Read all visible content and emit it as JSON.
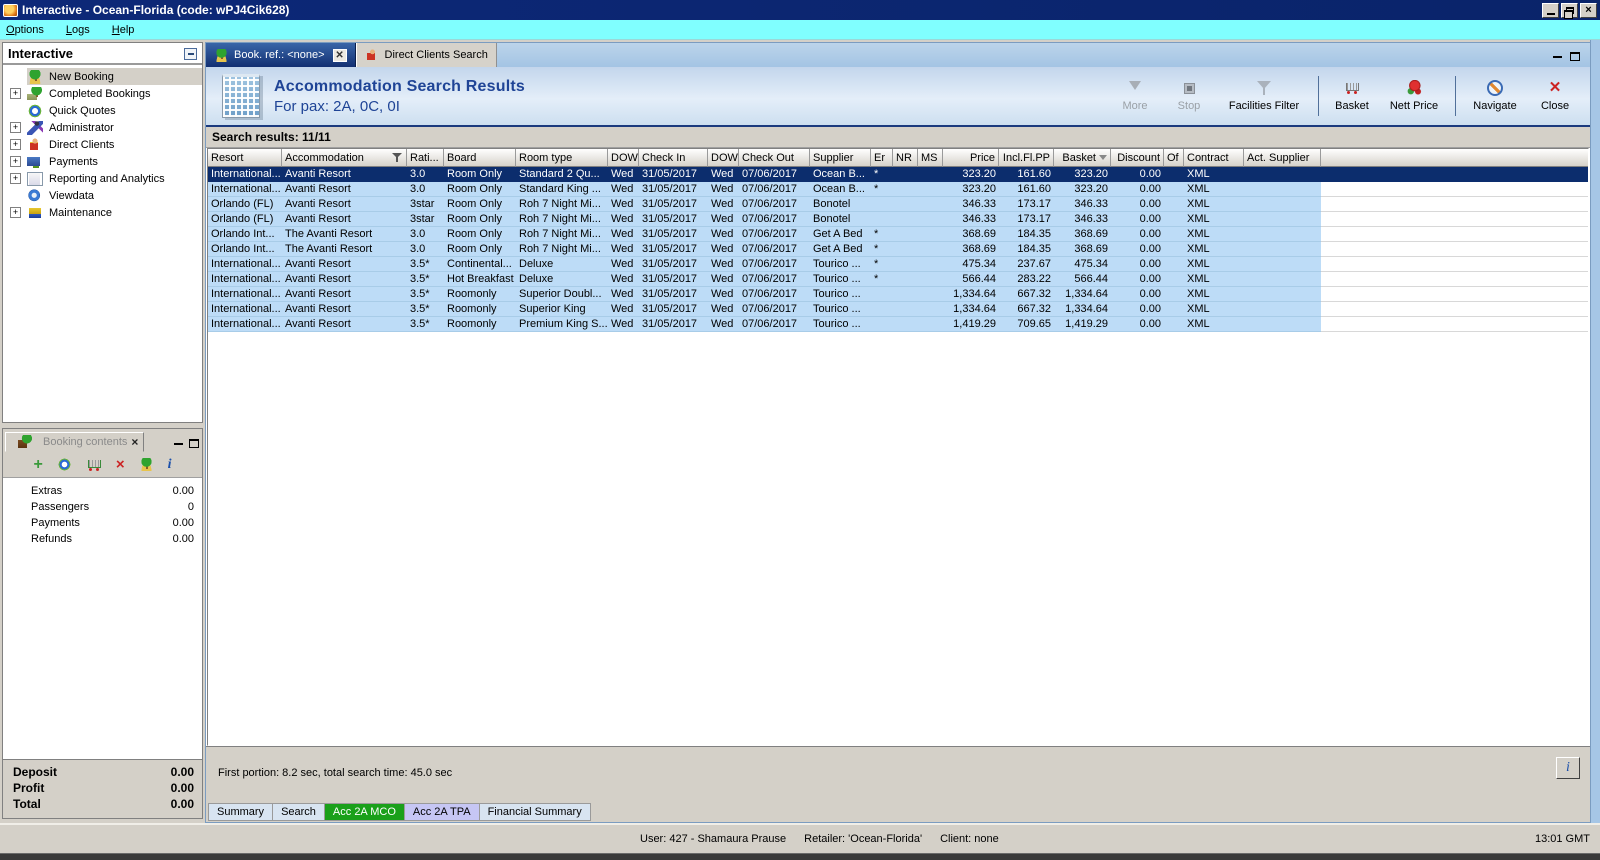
{
  "window": {
    "title": "Interactive - Ocean-Florida (code: wPJ4Cik628)",
    "time": "13:01 GMT",
    "status_user": "User: 427 - Shamaura Prause",
    "status_retailer": "Retailer: 'Ocean-Florida'",
    "status_client": "Client: none"
  },
  "menu": {
    "items": [
      "Options",
      "Logs",
      "Help"
    ]
  },
  "sidebar": {
    "title": "Interactive",
    "items": [
      {
        "label": "New Booking",
        "icon": "palm-tree-icon",
        "expandable": false,
        "selected": true
      },
      {
        "label": "Completed Bookings",
        "icon": "palm-money-icon",
        "expandable": true
      },
      {
        "label": "Quick Quotes",
        "icon": "clock-icon",
        "expandable": false
      },
      {
        "label": "Administrator",
        "icon": "admin-icon",
        "expandable": true
      },
      {
        "label": "Direct Clients",
        "icon": "person-icon",
        "expandable": true
      },
      {
        "label": "Payments",
        "icon": "payments-icon",
        "expandable": true
      },
      {
        "label": "Reporting and Analytics",
        "icon": "report-icon",
        "expandable": true
      },
      {
        "label": "Viewdata",
        "icon": "globe-icon",
        "expandable": false
      },
      {
        "label": "Maintenance",
        "icon": "toolbox-icon",
        "expandable": true
      }
    ]
  },
  "booking_contents": {
    "title": "Booking contents",
    "rows": [
      {
        "label": "Extras",
        "value": "0.00"
      },
      {
        "label": "Passengers",
        "value": "0"
      },
      {
        "label": "Payments",
        "value": "0.00"
      },
      {
        "label": "Refunds",
        "value": "0.00"
      }
    ],
    "totals": [
      {
        "label": "Deposit",
        "value": "0.00"
      },
      {
        "label": "Profit",
        "value": "0.00"
      },
      {
        "label": "Total",
        "value": "0.00"
      }
    ]
  },
  "tabs": {
    "active": "Book. ref.: <none>",
    "inactive": "Direct Clients Search"
  },
  "header": {
    "title": "Accommodation Search Results",
    "subtitle": "For pax: 2A, 0C, 0I",
    "buttons": {
      "more": "More",
      "stop": "Stop",
      "facilities": "Facilities Filter",
      "basket": "Basket",
      "nett": "Nett Price",
      "navigate": "Navigate",
      "close": "Close"
    }
  },
  "results": {
    "label": "Search results: 11/11",
    "columns": [
      "Resort",
      "Accommodation",
      "Rati...",
      "Board",
      "Room type",
      "DOW",
      "Check In",
      "DOW",
      "Check Out",
      "Supplier",
      "Er",
      "NR",
      "MS",
      "Price",
      "Incl.Fl.PP",
      "Basket",
      "Discount",
      "Of",
      "Contract",
      "Act. Supplier"
    ],
    "rows": [
      {
        "selected": true,
        "cells": [
          "International...",
          "Avanti Resort",
          "3.0",
          "Room Only",
          "Standard 2 Qu...",
          "Wed",
          "31/05/2017",
          "Wed",
          "07/06/2017",
          "Ocean B...",
          "*",
          "",
          "",
          "323.20",
          "161.60",
          "323.20",
          "0.00",
          "",
          "XML",
          ""
        ]
      },
      {
        "cells": [
          "International...",
          "Avanti Resort",
          "3.0",
          "Room Only",
          "Standard King ...",
          "Wed",
          "31/05/2017",
          "Wed",
          "07/06/2017",
          "Ocean B...",
          "*",
          "",
          "",
          "323.20",
          "161.60",
          "323.20",
          "0.00",
          "",
          "XML",
          ""
        ]
      },
      {
        "cells": [
          "Orlando (FL)",
          "Avanti Resort",
          "3star",
          "Room Only",
          "Roh 7 Night Mi...",
          "Wed",
          "31/05/2017",
          "Wed",
          "07/06/2017",
          "Bonotel",
          "",
          "",
          "",
          "346.33",
          "173.17",
          "346.33",
          "0.00",
          "",
          "XML",
          ""
        ]
      },
      {
        "cells": [
          "Orlando (FL)",
          "Avanti Resort",
          "3star",
          "Room Only",
          "Roh 7 Night Mi...",
          "Wed",
          "31/05/2017",
          "Wed",
          "07/06/2017",
          "Bonotel",
          "",
          "",
          "",
          "346.33",
          "173.17",
          "346.33",
          "0.00",
          "",
          "XML",
          ""
        ]
      },
      {
        "cells": [
          "Orlando Int...",
          "The Avanti Resort",
          "3.0",
          "Room Only",
          "Roh 7 Night Mi...",
          "Wed",
          "31/05/2017",
          "Wed",
          "07/06/2017",
          "Get A Bed",
          "*",
          "",
          "",
          "368.69",
          "184.35",
          "368.69",
          "0.00",
          "",
          "XML",
          ""
        ]
      },
      {
        "cells": [
          "Orlando Int...",
          "The Avanti Resort",
          "3.0",
          "Room Only",
          "Roh 7 Night Mi...",
          "Wed",
          "31/05/2017",
          "Wed",
          "07/06/2017",
          "Get A Bed",
          "*",
          "",
          "",
          "368.69",
          "184.35",
          "368.69",
          "0.00",
          "",
          "XML",
          ""
        ]
      },
      {
        "cells": [
          "International...",
          "Avanti Resort",
          "3.5*",
          "Continental...",
          "Deluxe",
          "Wed",
          "31/05/2017",
          "Wed",
          "07/06/2017",
          "Tourico ...",
          "*",
          "",
          "",
          "475.34",
          "237.67",
          "475.34",
          "0.00",
          "",
          "XML",
          ""
        ]
      },
      {
        "cells": [
          "International...",
          "Avanti Resort",
          "3.5*",
          "Hot Breakfast",
          "Deluxe",
          "Wed",
          "31/05/2017",
          "Wed",
          "07/06/2017",
          "Tourico ...",
          "*",
          "",
          "",
          "566.44",
          "283.22",
          "566.44",
          "0.00",
          "",
          "XML",
          ""
        ]
      },
      {
        "cells": [
          "International...",
          "Avanti Resort",
          "3.5*",
          "Roomonly",
          "Superior Doubl...",
          "Wed",
          "31/05/2017",
          "Wed",
          "07/06/2017",
          "Tourico ...",
          "",
          "",
          "",
          "1,334.64",
          "667.32",
          "1,334.64",
          "0.00",
          "",
          "XML",
          ""
        ]
      },
      {
        "cells": [
          "International...",
          "Avanti Resort",
          "3.5*",
          "Roomonly",
          "Superior King",
          "Wed",
          "31/05/2017",
          "Wed",
          "07/06/2017",
          "Tourico ...",
          "",
          "",
          "",
          "1,334.64",
          "667.32",
          "1,334.64",
          "0.00",
          "",
          "XML",
          ""
        ]
      },
      {
        "cells": [
          "International...",
          "Avanti Resort",
          "3.5*",
          "Roomonly",
          "Premium King S...",
          "Wed",
          "31/05/2017",
          "Wed",
          "07/06/2017",
          "Tourico ...",
          "",
          "",
          "",
          "1,419.29",
          "709.65",
          "1,419.29",
          "0.00",
          "",
          "XML",
          ""
        ]
      }
    ]
  },
  "footer": {
    "status": "First portion: 8.2 sec, total search time: 45.0 sec",
    "tabs": [
      {
        "label": "Summary"
      },
      {
        "label": "Search"
      },
      {
        "label": "Acc 2A MCO",
        "green": true
      },
      {
        "label": "Acc 2A TPA",
        "lavender": true
      },
      {
        "label": "Financial Summary"
      }
    ]
  },
  "colors": {
    "accent": "#0c2d6d",
    "row_blue": "#bddcf7",
    "tab_green": "#1aa01a",
    "tab_lavender": "#c6c6f4",
    "menubar": "#80ffff"
  }
}
